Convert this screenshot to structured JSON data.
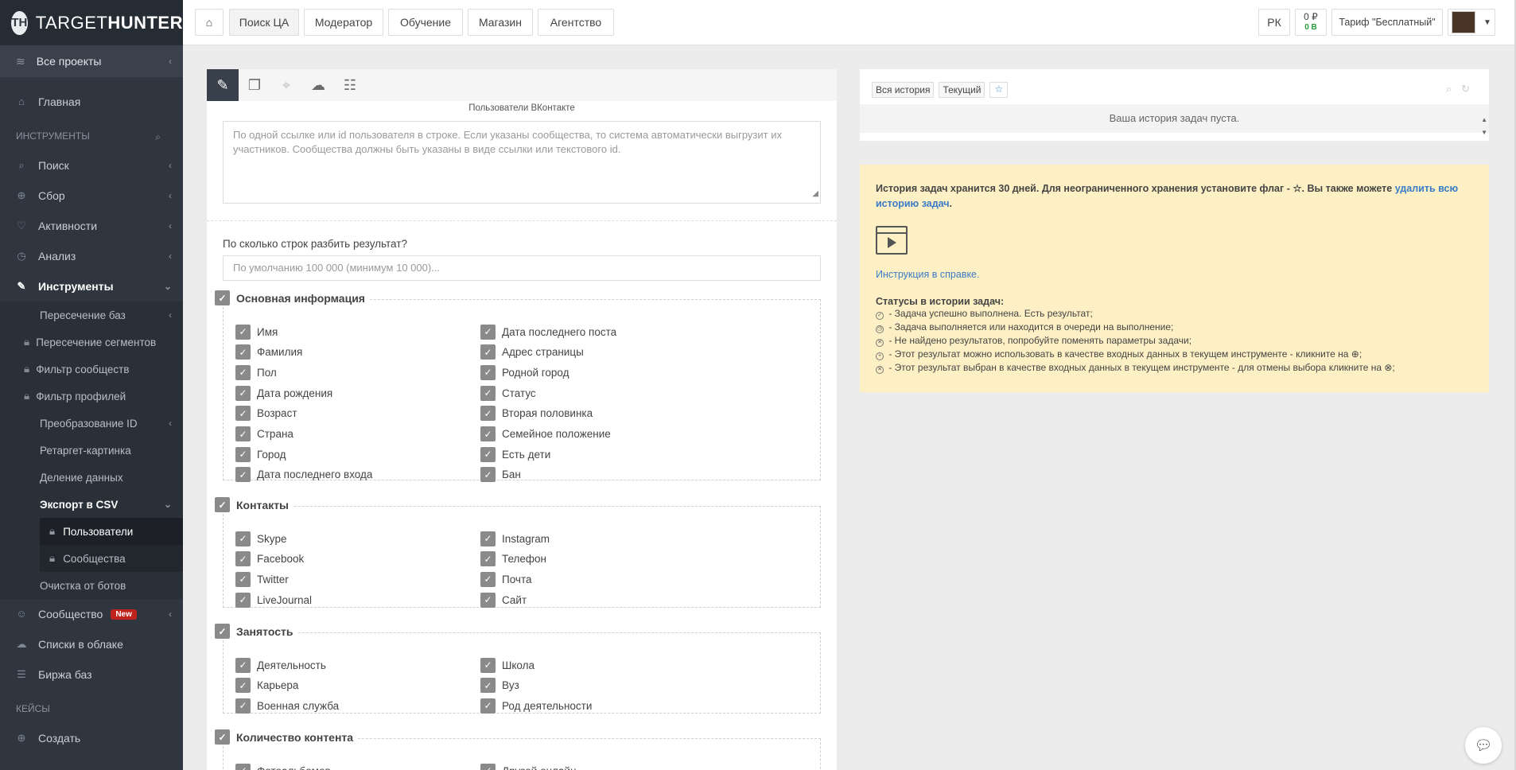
{
  "logo": {
    "mark": "TH",
    "text_light": "TARGET",
    "text_bold": "HUNTER"
  },
  "sidebar": {
    "projects": "Все проекты",
    "home": "Главная",
    "tools_section": "ИНСТРУМЕНТЫ",
    "main_items": [
      "Поиск",
      "Сбор",
      "Активности",
      "Анализ"
    ],
    "tools_item": "Инструменты",
    "sub_items": [
      "Пересечение баз",
      "Пересечение сегментов",
      "Фильтр сообществ",
      "Фильтр профилей",
      "Преобразование ID",
      "Ретаргет-картинка",
      "Деление данных",
      "Экспорт в CSV"
    ],
    "export_sub": [
      "Пользователи",
      "Сообщества"
    ],
    "bots": "Очистка от ботов",
    "community": "Сообщество",
    "community_badge": "New",
    "cloud_lists": "Списки в облаке",
    "exchange": "Биржа баз",
    "cases_section": "КЕЙСЫ",
    "create": "Создать"
  },
  "topbar": {
    "tabs": [
      "Поиск ЦА",
      "Модератор",
      "Обучение",
      "Магазин",
      "Агентство"
    ],
    "active_tab": "Поиск ЦА",
    "rk": "РК",
    "balance_rub": "0 ₽",
    "balance_v": "0 В",
    "tariff": "Тариф \"Бесплатный\""
  },
  "form": {
    "caption": "Пользователи ВКонтакте",
    "textarea_placeholder": "По одной ссылке или id пользователя в строке. Если указаны сообщества, то система автоматически выгрузит их участников. Сообщества должны быть указаны в виде ссылки или текстового id.",
    "split_label": "По сколько строк разбить результат?",
    "split_placeholder": "По умолчанию 100 000 (минимум 10 000)...",
    "groups": [
      {
        "title": "Основная информация",
        "left": [
          "Имя",
          "Фамилия",
          "Пол",
          "Дата рождения",
          "Возраст",
          "Страна",
          "Город",
          "Дата последнего входа"
        ],
        "right": [
          "Дата последнего поста",
          "Адрес страницы",
          "Родной город",
          "Статус",
          "Вторая половинка",
          "Семейное положение",
          "Есть дети",
          "Бан"
        ]
      },
      {
        "title": "Контакты",
        "left": [
          "Skype",
          "Facebook",
          "Twitter",
          "LiveJournal"
        ],
        "right": [
          "Instagram",
          "Телефон",
          "Почта",
          "Сайт"
        ]
      },
      {
        "title": "Занятость",
        "left": [
          "Деятельность",
          "Карьера",
          "Военная служба"
        ],
        "right": [
          "Школа",
          "Вуз",
          "Род деятельности"
        ]
      },
      {
        "title": "Количество контента",
        "left": [
          "Фотоальбомов"
        ],
        "right": [
          "Друзей онлайн"
        ]
      }
    ]
  },
  "history": {
    "tab_all": "Вся история",
    "tab_current": "Текущий",
    "empty": "Ваша история задач пуста."
  },
  "info": {
    "intro_1": "История задач хранится 30 дней. Для неограниченного хранения установите флаг - ☆. Вы также можете ",
    "intro_link": "удалить всю историю задач",
    "intro_end": ".",
    "help_link": "Инструкция в справке.",
    "status_title": "Статусы в истории задач:",
    "statuses": [
      {
        "icon": "✓",
        "text": " - Задача успешно выполнена. Есть результат;"
      },
      {
        "icon": "◷",
        "text": " - Задача выполняется или находится в очереди на выполнение;"
      },
      {
        "icon": "✕",
        "text": " - Не найдено результатов, попробуйте поменять параметры задачи;"
      },
      {
        "icon": "+",
        "text": " - Этот результат можно использовать в качестве входных данных в текущем инструменте - кликните на ⊕;"
      },
      {
        "icon": "✕",
        "text": " - Этот результат выбран в качестве входных данных в текущем инструменте - для отмены выбора кликните на ⊗;"
      }
    ]
  }
}
